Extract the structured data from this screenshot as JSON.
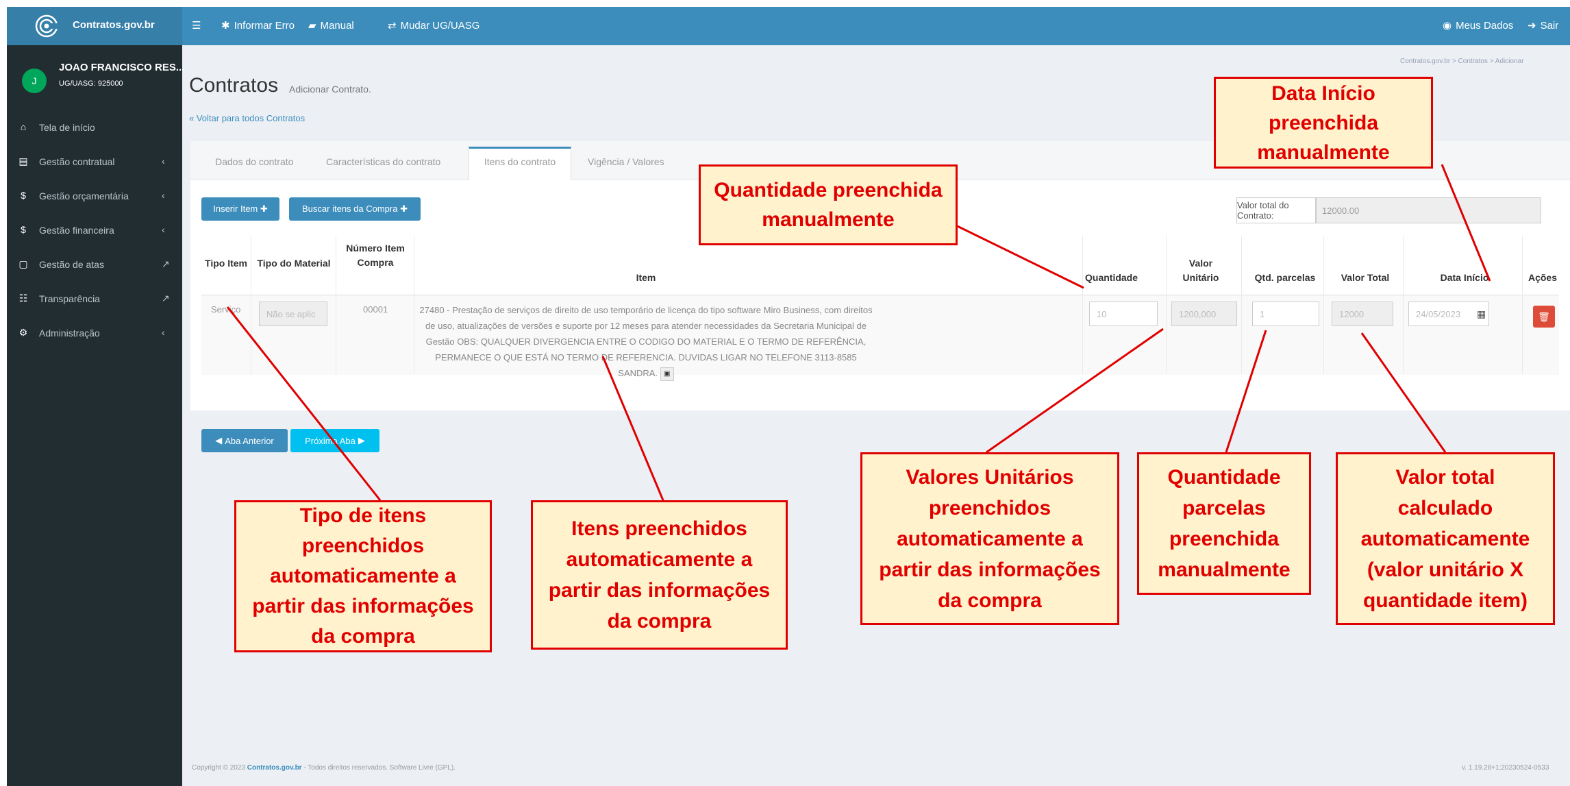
{
  "topbar": {
    "brand": "Contratos.gov.br",
    "menu_icon": "hamburger-icon",
    "items": [
      {
        "label": "Informar Erro",
        "icon": "bug-icon"
      },
      {
        "label": "Manual",
        "icon": "book-icon"
      },
      {
        "label": "Mudar UG/UASG",
        "icon": "exchange-icon"
      }
    ],
    "right": [
      {
        "label": "Meus Dados",
        "icon": "user-circle-icon"
      },
      {
        "label": "Sair",
        "icon": "sign-out-icon"
      }
    ]
  },
  "user": {
    "initial": "J",
    "name": "JOAO FRANCISCO RES...",
    "ug": "UG/UASG: 925000"
  },
  "sidebar": {
    "items": [
      {
        "label": "Tela de início",
        "icon": "home-icon"
      },
      {
        "label": "Gestão contratual",
        "icon": "file-icon"
      },
      {
        "label": "Gestão orçamentária",
        "icon": "dollar-icon"
      },
      {
        "label": "Gestão financeira",
        "icon": "dollar-icon"
      },
      {
        "label": "Gestão de atas",
        "icon": "file-outline-icon"
      },
      {
        "label": "Transparência",
        "icon": "list-icon"
      },
      {
        "label": "Administração",
        "icon": "cogs-icon"
      }
    ]
  },
  "breadcrumb": "Contratos.gov.br  >  Contratos  >  Adicionar",
  "page": {
    "title": "Contratos",
    "subtitle": "Adicionar Contrato.",
    "back": "« Voltar para todos Contratos"
  },
  "tabs": [
    "Dados do contrato",
    "Características do contrato",
    "Itens do contrato",
    "Vigência / Valores"
  ],
  "actions": {
    "insert": "Inserir Item ✚",
    "search": "Buscar itens da Compra ✚"
  },
  "valor_total": {
    "label": "Valor total do Contrato:",
    "value": "12000.00"
  },
  "table": {
    "headers": {
      "tipo_item": "Tipo Item",
      "tipo_material": "Tipo do Material",
      "numero": "Número Item Compra",
      "item": "Item",
      "quantidade": "Quantidade",
      "valor_unitario": "Valor Unitário",
      "parcelas": "Qtd. parcelas",
      "valor_total": "Valor Total",
      "data_inicio": "Data Início",
      "acoes": "Ações"
    },
    "row": {
      "tipo_item": "Serviço",
      "tipo_material": "Não se aplic",
      "numero": "00001",
      "item": "27480 - Prestação de serviços de direito de uso temporário de licença do tipo software Miro Business, com direitos de uso, atualizações de versões e suporte por 12 meses para atender necessidades da Secretaria Municipal de Gestão OBS: QUALQUER DIVERGENCIA ENTRE O CODIGO DO MATERIAL E O TERMO DE REFERÊNCIA, PERMANECE O QUE ESTÁ NO TERMO DE REFERENCIA. DUVIDAS LIGAR NO TELEFONE 3113-8585 SANDRA.",
      "quantidade": "10",
      "valor_unitario": "1200,000",
      "parcelas": "1",
      "valor_total": "12000",
      "data_inicio": "24/05/2023"
    }
  },
  "nav": {
    "prev": "Aba Anterior",
    "next": "Próxima Aba"
  },
  "footer": {
    "copyright": "Copyright © 2023",
    "brand": "Contratos.gov.br",
    "rest": " - Todos direitos reservados. Software Livre (GPL).",
    "version": "v. 1.19.28+1;20230524-0533"
  },
  "callouts": {
    "data_inicio": [
      "Data Início",
      "preenchida",
      "manualmente"
    ],
    "quantidade": [
      "Quantidade preenchida",
      "manualmente"
    ],
    "tipo_itens": [
      "Tipo de itens",
      "preenchidos",
      "automaticamente a",
      "partir das informações",
      "da compra"
    ],
    "itens": [
      "Itens preenchidos",
      "automaticamente a",
      "partir das informações",
      "da compra"
    ],
    "valores_unitarios": [
      "Valores Unitários",
      "preenchidos",
      "automaticamente a",
      "partir das informações",
      "da compra"
    ],
    "parcelas": [
      "Quantidade",
      "parcelas",
      "preenchida",
      "manualmente"
    ],
    "valor_total": [
      "Valor total",
      "calculado",
      "automaticamente",
      "(valor unitário X",
      "quantidade item)"
    ]
  },
  "colors": {
    "accent": "#3c8dbc",
    "sidebar": "#222d32",
    "callout_border": "#e00000",
    "callout_fill": "#fff2cc",
    "danger": "#dd4b39"
  }
}
